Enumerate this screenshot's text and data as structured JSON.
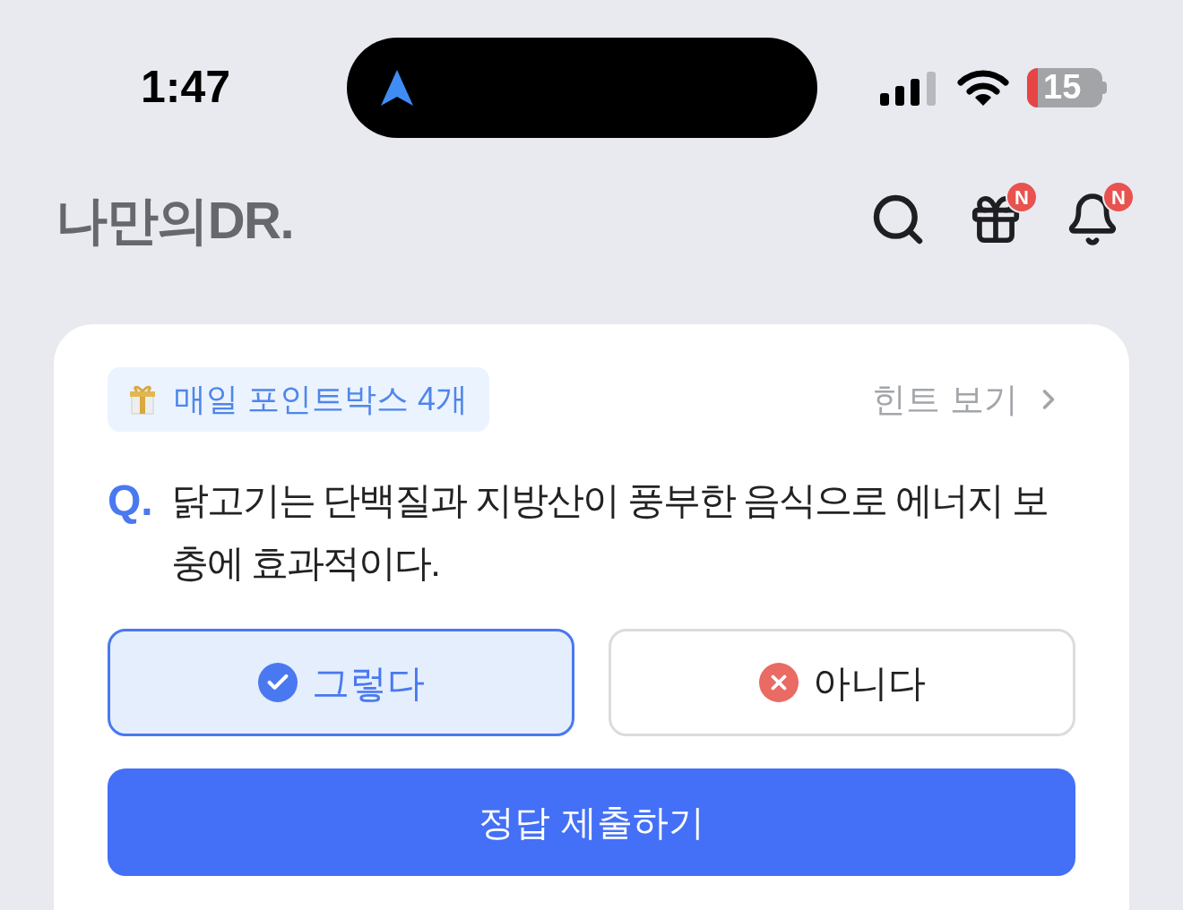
{
  "status_bar": {
    "time": "1:47",
    "battery": "15"
  },
  "header": {
    "logo": "나만의DR.",
    "badges": [
      {
        "kind": "gift",
        "label": "N"
      },
      {
        "kind": "bell",
        "label": "N"
      }
    ]
  },
  "quiz": {
    "points_chip": "매일 포인트박스 4개",
    "hint_link": "힌트 보기",
    "q_mark": "Q.",
    "question": "닭고기는 단백질과 지방산이 풍부한 음식으로 에너지 보충에 효과적이다.",
    "options": [
      {
        "kind": "yes",
        "label": "그렇다",
        "selected": true
      },
      {
        "kind": "no",
        "label": "아니다",
        "selected": false
      }
    ],
    "submit": "정답 제출하기"
  }
}
